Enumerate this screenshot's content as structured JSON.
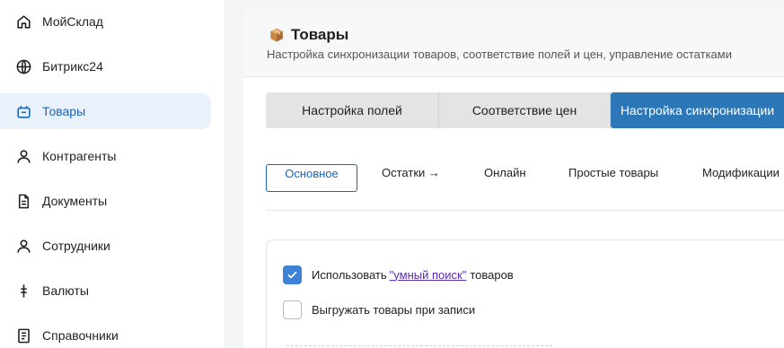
{
  "sidebar": {
    "items": [
      {
        "label": "МойСклад",
        "icon": "home-icon",
        "active": false
      },
      {
        "label": "Битрикс24",
        "icon": "globe-icon",
        "active": false
      },
      {
        "label": "Товары",
        "icon": "cart-icon",
        "active": true
      },
      {
        "label": "Контрагенты",
        "icon": "person-icon",
        "active": false
      },
      {
        "label": "Документы",
        "icon": "document-icon",
        "active": false
      },
      {
        "label": "Сотрудники",
        "icon": "person-icon",
        "active": false
      },
      {
        "label": "Валюты",
        "icon": "currency-icon",
        "active": false
      },
      {
        "label": "Справочники",
        "icon": "book-icon",
        "active": false
      }
    ]
  },
  "header": {
    "title": "Товары",
    "title_icon": "package-icon",
    "subtitle": "Настройка синхронизации товаров, соответствие полей и цен, управление остатками"
  },
  "segments": [
    "Настройка полей",
    "Соответствие цен",
    "Настройка синхронизации"
  ],
  "active_segment": "Настройка синхронизации",
  "subtabs": [
    "Основное",
    "Остатки →",
    "Онлайн",
    "Простые товары",
    "Модификации"
  ],
  "active_subtab": "Основное",
  "options": {
    "smart_search": {
      "prefix": "Использовать",
      "link": "\"умный поиск\"",
      "suffix": "товаров",
      "checked": true
    },
    "export_on_save": {
      "label": "Выгружать товары при записи",
      "checked": false
    }
  },
  "colors": {
    "accent": "#2b77b8",
    "active_nav_bg": "#e9f1fb",
    "checkbox_on": "#3d82d6",
    "link": "#5a2bb0"
  }
}
